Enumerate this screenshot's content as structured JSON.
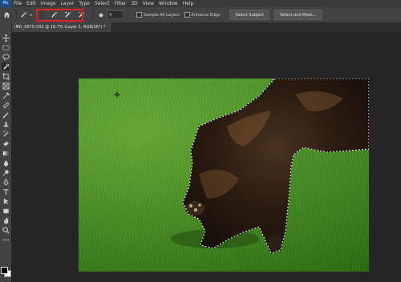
{
  "menu": {
    "logo": "Ps",
    "items": [
      "File",
      "Edit",
      "Image",
      "Layer",
      "Type",
      "Select",
      "Filter",
      "3D",
      "View",
      "Window",
      "Help"
    ]
  },
  "options": {
    "brush_size": "9",
    "sample_all_layers": "Sample All Layers",
    "enhance_edge": "Enhance Edge",
    "select_subject": "Select Subject",
    "select_and_mask": "Select and Mask..."
  },
  "document_tab": {
    "title": "IMG_5875.CR2 @ 16.7% (Layer 1, RGB/16*) *",
    "close": "×"
  },
  "colors": {
    "highlight": "#e02424",
    "foreground": "#000000",
    "background": "#ffffff"
  }
}
